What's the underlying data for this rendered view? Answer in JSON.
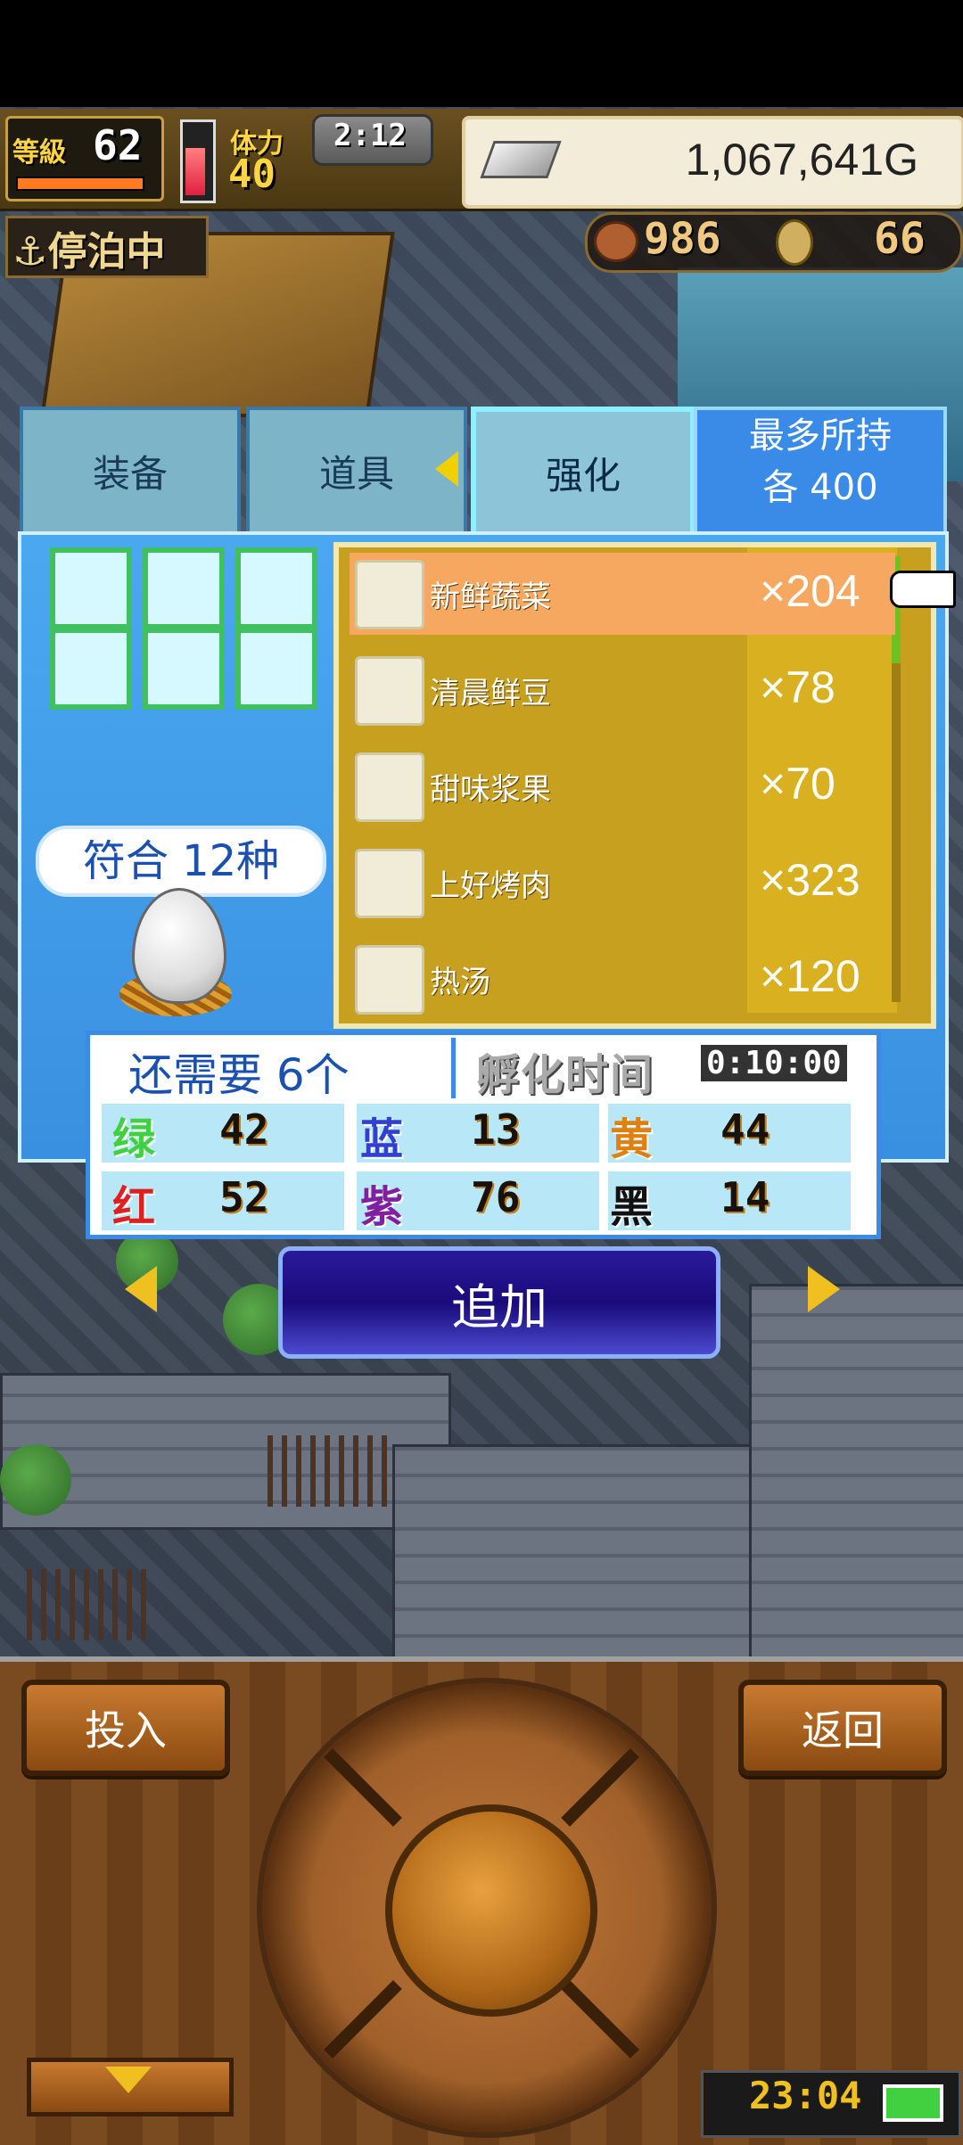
{
  "hud": {
    "level_label": "等級",
    "level_value": "62",
    "stamina_label": "体力",
    "stamina_value": "40",
    "time_remaining": "2:12",
    "gold": "1,067,641G",
    "dock_status": "停泊中",
    "meat_count": "986",
    "coin_count": "66",
    "hp_level": 0.65
  },
  "tabs": {
    "equip": "装备",
    "items": "道具",
    "enhance": "强化",
    "max_line1": "最多所持",
    "max_line2": "各 400"
  },
  "match_count": "符合 12种",
  "items": [
    {
      "name": "新鲜蔬菜",
      "qty": "×204",
      "icon": "vegetable-icon",
      "selected": true
    },
    {
      "name": "清晨鲜豆",
      "qty": "×78",
      "icon": "beans-icon",
      "selected": false
    },
    {
      "name": "甜味浆果",
      "qty": "×70",
      "icon": "berries-icon",
      "selected": false
    },
    {
      "name": "上好烤肉",
      "qty": "×323",
      "icon": "roast-meat-icon",
      "selected": false
    },
    {
      "name": "热汤",
      "qty": "×120",
      "icon": "soup-icon",
      "selected": false
    }
  ],
  "info": {
    "need": "还需要 6个",
    "hatch_label": "孵化时间",
    "hatch_value": "0:10:00"
  },
  "colors_stats": [
    {
      "label": "绿",
      "value": "42",
      "color": "#40d040"
    },
    {
      "label": "蓝",
      "value": "13",
      "color": "#3040d0"
    },
    {
      "label": "黄",
      "value": "44",
      "color": "#e08010"
    },
    {
      "label": "红",
      "value": "52",
      "color": "#e02020"
    },
    {
      "label": "紫",
      "value": "76",
      "color": "#8020a0"
    },
    {
      "label": "黑",
      "value": "14",
      "color": "#111111"
    }
  ],
  "add_button": "追加",
  "controller": {
    "insert_label": "投入",
    "back_label": "返回"
  },
  "system_clock": "23:04"
}
